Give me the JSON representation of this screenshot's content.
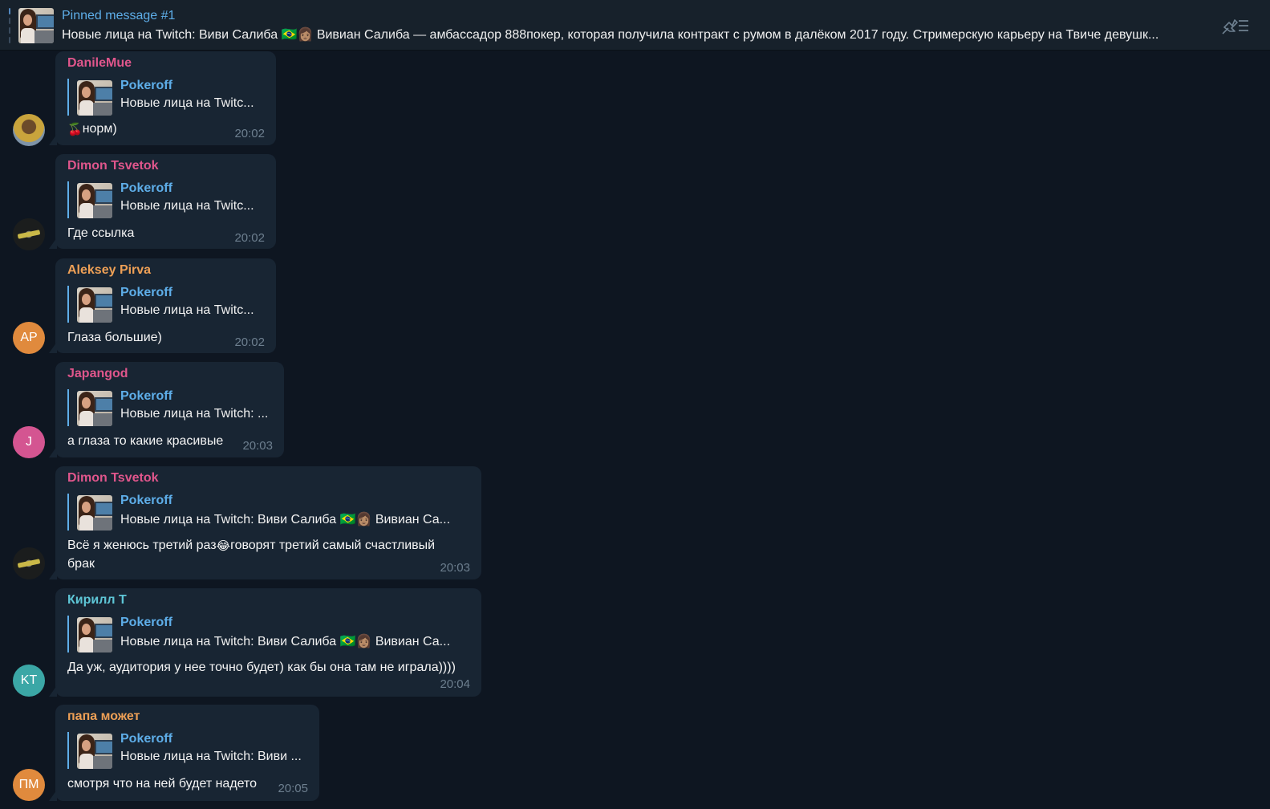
{
  "pinned": {
    "title": "Pinned message #1",
    "text": "Новые лица на Twitch: Виви Салиба 🇧🇷👩🏽 Вивиан Салиба — амбассадор 888покер, которая получила контракт с румом в далёком 2017 году. Стримерскую карьеру на Твиче девушк...",
    "icon": "pinned-list-icon"
  },
  "colors": {
    "background": "#0e1621",
    "bubble": "#182533",
    "reply_accent": "#5eaee9",
    "time": "#6d7f8f"
  },
  "messages": [
    {
      "author": "DanileMue",
      "author_color": "#e0568c",
      "avatar_initials": "",
      "reply_name": "Pokeroff",
      "reply_text": "Новые лица на Twitc...",
      "text_emoji": "🍒",
      "text": "норм)",
      "time": "20:02"
    },
    {
      "author": "Dimon Tsvetok",
      "author_color": "#e0568c",
      "avatar_initials": "",
      "reply_name": "Pokeroff",
      "reply_text": "Новые лица на Twitc...",
      "text": "Где ссылка",
      "time": "20:02"
    },
    {
      "author": "Aleksey Pirva",
      "author_color": "#eea056",
      "avatar_initials": "AP",
      "avatar_color": "#e08a3d",
      "reply_name": "Pokeroff",
      "reply_text": "Новые лица на Twitc...",
      "text": "Глаза большие)",
      "time": "20:02"
    },
    {
      "author": "Japangod",
      "author_color": "#e0568c",
      "avatar_initials": "J",
      "avatar_color": "#d45591",
      "reply_name": "Pokeroff",
      "reply_text": "Новые лица на Twitch: ...",
      "text": "а глаза то какие красивые",
      "time": "20:03"
    },
    {
      "author": "Dimon Tsvetok",
      "author_color": "#e0568c",
      "avatar_initials": "",
      "reply_name": "Pokeroff",
      "reply_text": "Новые лица на Twitch: Виви Салиба 🇧🇷👩🏽 Вивиан Са...",
      "text_a": "Всё я женюсь третий раз",
      "text_emoji": "😂",
      "text_b": "говорят третий самый счастливый брак",
      "time": "20:03"
    },
    {
      "author": "Кирилл Т",
      "author_color": "#5ec6d6",
      "avatar_initials": "KT",
      "avatar_color": "#3ba7a6",
      "reply_name": "Pokeroff",
      "reply_text": "Новые лица на Twitch: Виви Салиба 🇧🇷👩🏽 Вивиан Са...",
      "text": "Да уж, аудитория у нее точно будет) как бы она там не играла))))",
      "time": "20:04"
    },
    {
      "author": "папа может",
      "author_color": "#eea056",
      "avatar_initials": "ПМ",
      "avatar_color": "#e08a3d",
      "reply_name": "Pokeroff",
      "reply_text": "Новые лица на Twitch: Виви ...",
      "text": "смотря что на ней будет надето",
      "time": "20:05"
    }
  ]
}
